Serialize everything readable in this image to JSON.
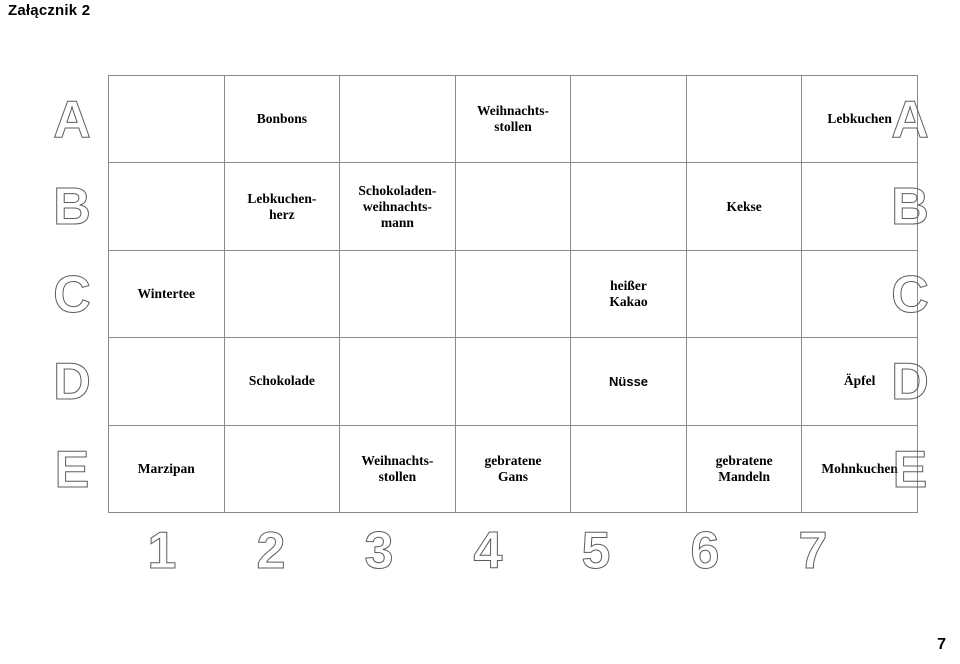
{
  "document": {
    "title": "Załącznik 2",
    "page_number": "7"
  },
  "grid": {
    "row_labels": [
      "A",
      "B",
      "C",
      "D",
      "E"
    ],
    "column_labels": [
      "1",
      "2",
      "3",
      "4",
      "5",
      "6",
      "7"
    ],
    "rows": [
      {
        "label": "A",
        "cells": [
          {
            "text": "",
            "font": "serif"
          },
          {
            "text": "Bonbons",
            "font": "serif"
          },
          {
            "text": "",
            "font": "serif"
          },
          {
            "text": "Weihnachts-\nstollen",
            "font": "serif"
          },
          {
            "text": "",
            "font": "serif"
          },
          {
            "text": "",
            "font": "serif"
          },
          {
            "text": "Lebkuchen",
            "font": "serif"
          }
        ]
      },
      {
        "label": "B",
        "cells": [
          {
            "text": "",
            "font": "serif"
          },
          {
            "text": "Lebkuchen-\nherz",
            "font": "serif"
          },
          {
            "text": "Schokoladen-\nweihnachts-\nmann",
            "font": "serif"
          },
          {
            "text": "",
            "font": "serif"
          },
          {
            "text": "",
            "font": "serif"
          },
          {
            "text": "Kekse",
            "font": "serif"
          },
          {
            "text": "",
            "font": "serif"
          }
        ]
      },
      {
        "label": "C",
        "cells": [
          {
            "text": "Wintertee",
            "font": "serif"
          },
          {
            "text": "",
            "font": "serif"
          },
          {
            "text": "",
            "font": "serif"
          },
          {
            "text": "",
            "font": "serif"
          },
          {
            "text": "heißer\nKakao",
            "font": "serif"
          },
          {
            "text": "",
            "font": "serif"
          },
          {
            "text": "",
            "font": "serif"
          }
        ]
      },
      {
        "label": "D",
        "cells": [
          {
            "text": "",
            "font": "serif"
          },
          {
            "text": "Schokolade",
            "font": "serif"
          },
          {
            "text": "",
            "font": "serif"
          },
          {
            "text": "",
            "font": "serif"
          },
          {
            "text": "Nüsse",
            "font": "sans"
          },
          {
            "text": "",
            "font": "serif"
          },
          {
            "text": "Äpfel",
            "font": "serif"
          }
        ]
      },
      {
        "label": "E",
        "cells": [
          {
            "text": "Marzipan",
            "font": "serif"
          },
          {
            "text": "",
            "font": "serif"
          },
          {
            "text": "Weihnachts-\nstollen",
            "font": "serif"
          },
          {
            "text": "gebratene\nGans",
            "font": "serif"
          },
          {
            "text": "",
            "font": "serif"
          },
          {
            "text": "gebratene\nMandeln",
            "font": "serif"
          },
          {
            "text": "Mohnkuchen",
            "font": "serif"
          }
        ]
      }
    ]
  },
  "colors": {
    "grid_line": "#8a8a8a",
    "marker_outline": "#5d5d5d",
    "text": "#000000",
    "background": "#ffffff"
  }
}
